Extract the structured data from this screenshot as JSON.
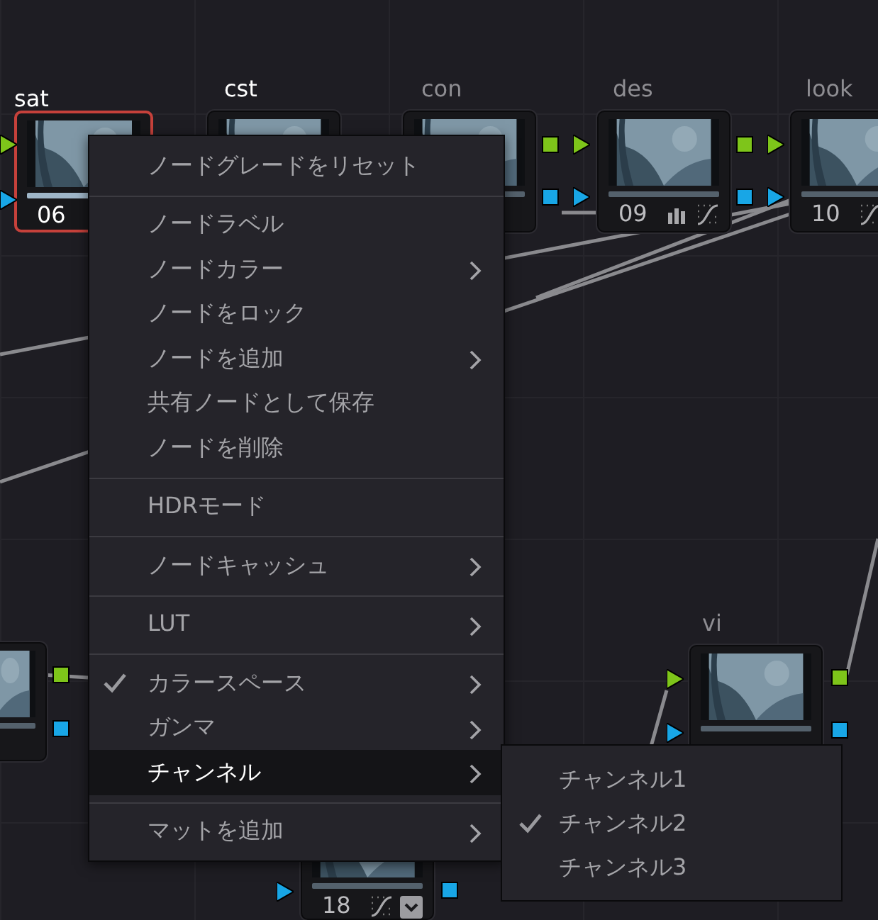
{
  "nodes": [
    {
      "label": "sat",
      "label_bright": true,
      "number": "06",
      "selected": true
    },
    {
      "label": "cst",
      "label_bright": true,
      "selected": false
    },
    {
      "label": "con",
      "label_bright": false,
      "selected": false
    },
    {
      "label": "des",
      "label_bright": false,
      "number": "09",
      "selected": false
    },
    {
      "label": "look",
      "label_bright": false,
      "number": "10",
      "selected": false
    },
    {
      "selected": false
    },
    {
      "label": "vi",
      "label_bright": false,
      "selected": false
    },
    {
      "number": "18",
      "selected": false
    }
  ],
  "context_menu": {
    "groups": [
      [
        {
          "label": "ノードグレードをリセット",
          "checked": false,
          "submenu": false,
          "selected": false
        }
      ],
      [
        {
          "label": "ノードラベル",
          "checked": false,
          "submenu": false,
          "selected": false
        },
        {
          "label": "ノードカラー",
          "checked": false,
          "submenu": true,
          "selected": false
        },
        {
          "label": "ノードをロック",
          "checked": false,
          "submenu": false,
          "selected": false
        },
        {
          "label": "ノードを追加",
          "checked": false,
          "submenu": true,
          "selected": false
        },
        {
          "label": "共有ノードとして保存",
          "checked": false,
          "submenu": false,
          "selected": false
        },
        {
          "label": "ノードを削除",
          "checked": false,
          "submenu": false,
          "selected": false
        }
      ],
      [
        {
          "label": "HDRモード",
          "checked": false,
          "submenu": false,
          "selected": false
        }
      ],
      [
        {
          "label": "ノードキャッシュ",
          "checked": false,
          "submenu": true,
          "selected": false
        }
      ],
      [
        {
          "label": "LUT",
          "checked": false,
          "submenu": true,
          "selected": false
        }
      ],
      [
        {
          "label": "カラースペース",
          "checked": true,
          "submenu": true,
          "selected": false
        },
        {
          "label": "ガンマ",
          "checked": false,
          "submenu": true,
          "selected": false
        },
        {
          "label": "チャンネル",
          "checked": false,
          "submenu": true,
          "selected": true
        }
      ],
      [
        {
          "label": "マットを追加",
          "checked": false,
          "submenu": true,
          "selected": false
        }
      ]
    ]
  },
  "submenu": {
    "items": [
      {
        "label": "チャンネル1",
        "checked": false
      },
      {
        "label": "チャンネル2",
        "checked": true
      },
      {
        "label": "チャンネル3",
        "checked": false
      }
    ]
  }
}
